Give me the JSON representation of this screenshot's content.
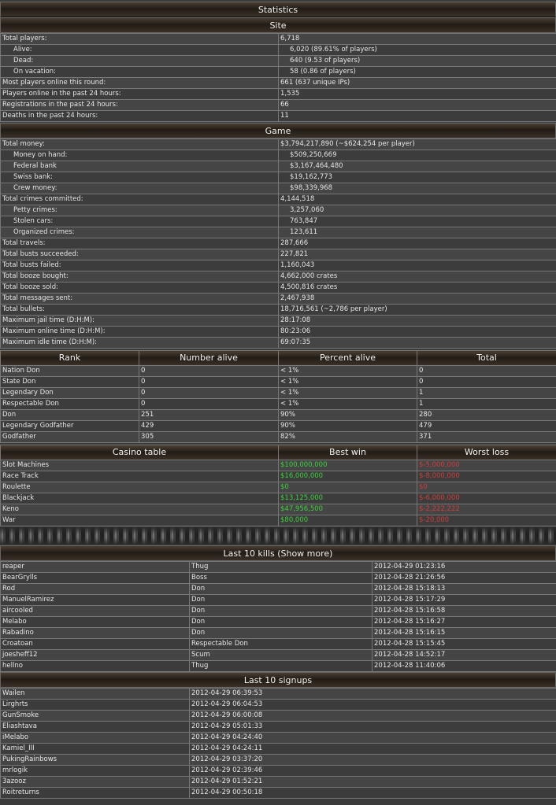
{
  "title": "Statistics",
  "site": {
    "heading": "Site",
    "rows": [
      {
        "label": "Total players:",
        "value": "6,718",
        "ind": false
      },
      {
        "label": "Alive:",
        "value": "6,020 (89.61% of players)",
        "ind": true
      },
      {
        "label": "Dead:",
        "value": "640 (9.53 of players)",
        "ind": true
      },
      {
        "label": "On vacation:",
        "value": "58 (0.86 of players)",
        "ind": true
      },
      {
        "label": "Most players online this round:",
        "value": "661 (637 unique IPs)",
        "ind": false
      },
      {
        "label": "Players online in the past 24 hours:",
        "value": "1,535",
        "ind": false
      },
      {
        "label": "Registrations in the past 24 hours:",
        "value": "66",
        "ind": false
      },
      {
        "label": "Deaths in the past 24 hours:",
        "value": "11",
        "ind": false
      }
    ]
  },
  "game": {
    "heading": "Game",
    "rows": [
      {
        "label": "Total money:",
        "value": "$3,794,217,890 (~$624,254 per player)",
        "ind": false
      },
      {
        "label": "Money on hand:",
        "value": "$509,250,669",
        "ind": true
      },
      {
        "label": "Federal bank",
        "value": "$3,167,464,480",
        "ind": true
      },
      {
        "label": "Swiss bank:",
        "value": "$19,162,773",
        "ind": true
      },
      {
        "label": "Crew money:",
        "value": "$98,339,968",
        "ind": true
      },
      {
        "label": "Total crimes committed:",
        "value": "4,144,518",
        "ind": false
      },
      {
        "label": "Petty crimes:",
        "value": "3,257,060",
        "ind": true
      },
      {
        "label": "Stolen cars:",
        "value": "763,847",
        "ind": true
      },
      {
        "label": "Organized crimes:",
        "value": "123,611",
        "ind": true
      },
      {
        "label": "Total travels:",
        "value": "287,666",
        "ind": false
      },
      {
        "label": "Total busts succeeded:",
        "value": "227,821",
        "ind": false
      },
      {
        "label": "Total busts failed:",
        "value": "1,160,043",
        "ind": false
      },
      {
        "label": "Total booze bought:",
        "value": "4,662,000 crates",
        "ind": false
      },
      {
        "label": "Total booze sold:",
        "value": "4,500,816 crates",
        "ind": false
      },
      {
        "label": "Total messages sent:",
        "value": "2,467,938",
        "ind": false
      },
      {
        "label": "Total bullets:",
        "value": "18,716,561 (~2,786 per player)",
        "ind": false
      },
      {
        "label": "Maximum jail time (D:H:M):",
        "value": "28:17:08",
        "ind": false
      },
      {
        "label": "Maximum online time (D:H:M):",
        "value": "80:23:06",
        "ind": false
      },
      {
        "label": "Maximum idle time (D:H:M):",
        "value": "69:07:35",
        "ind": false
      }
    ]
  },
  "ranks": {
    "headers": [
      "Rank",
      "Number alive",
      "Percent alive",
      "Total"
    ],
    "rows": [
      [
        "Nation Don",
        "0",
        "< 1%",
        "0"
      ],
      [
        "State Don",
        "0",
        "< 1%",
        "0"
      ],
      [
        "Legendary Don",
        "0",
        "< 1%",
        "1"
      ],
      [
        "Respectable Don",
        "0",
        "< 1%",
        "1"
      ],
      [
        "Don",
        "251",
        "90%",
        "280"
      ],
      [
        "Legendary Godfather",
        "429",
        "90%",
        "479"
      ],
      [
        "Godfather",
        "305",
        "82%",
        "371"
      ]
    ]
  },
  "casino": {
    "headers": [
      "Casino table",
      "Best win",
      "Worst loss"
    ],
    "rows": [
      [
        "Slot Machines",
        "$100,000,000",
        "$-5,000,000"
      ],
      [
        "Race Track",
        "$16,000,000",
        "$-8,000,000"
      ],
      [
        "Roulette",
        "$0",
        "$0"
      ],
      [
        "Blackjack",
        "$13,125,000",
        "$-6,000,000"
      ],
      [
        "Keno",
        "$47,956,500",
        "$-2,222,222"
      ],
      [
        "War",
        "$80,000",
        "$-20,000"
      ]
    ]
  },
  "kills": {
    "heading": "Last 10 kills (Show more)",
    "rows": [
      [
        "reaper",
        "Thug",
        "2012-04-29 01:23:16"
      ],
      [
        "BearGrylls",
        "Boss",
        "2012-04-28 21:26:56"
      ],
      [
        "Rod",
        "Don",
        "2012-04-28 15:18:13"
      ],
      [
        "ManuelRamirez",
        "Don",
        "2012-04-28 15:17:29"
      ],
      [
        "aircooled",
        "Don",
        "2012-04-28 15:16:58"
      ],
      [
        "Melabo",
        "Don",
        "2012-04-28 15:16:27"
      ],
      [
        "Rabadino",
        "Don",
        "2012-04-28 15:16:15"
      ],
      [
        "Croatoan",
        "Respectable Don",
        "2012-04-28 15:15:45"
      ],
      [
        "joesheff12",
        "Scum",
        "2012-04-28 14:52:17"
      ],
      [
        "hellno",
        "Thug",
        "2012-04-28 11:40:06"
      ]
    ]
  },
  "signups": {
    "heading": "Last 10 signups",
    "rows": [
      [
        "Wailen",
        "2012-04-29 06:39:53"
      ],
      [
        "Lirghrts",
        "2012-04-29 06:04:53"
      ],
      [
        "GunSmoke",
        "2012-04-29 06:00:08"
      ],
      [
        "Eliashtava",
        "2012-04-29 05:01:33"
      ],
      [
        "iMelabo",
        "2012-04-29 04:24:40"
      ],
      [
        "Kamiel_III",
        "2012-04-29 04:24:11"
      ],
      [
        "PukingRainbows",
        "2012-04-29 03:37:20"
      ],
      [
        "mrlogik",
        "2012-04-29 02:39:46"
      ],
      [
        "3azooz",
        "2012-04-29 01:52:21"
      ],
      [
        "Roitreturns",
        "2012-04-29 00:50:18"
      ]
    ]
  },
  "colors": {
    "win": "#3cd23c",
    "loss": "#d23c3c"
  }
}
